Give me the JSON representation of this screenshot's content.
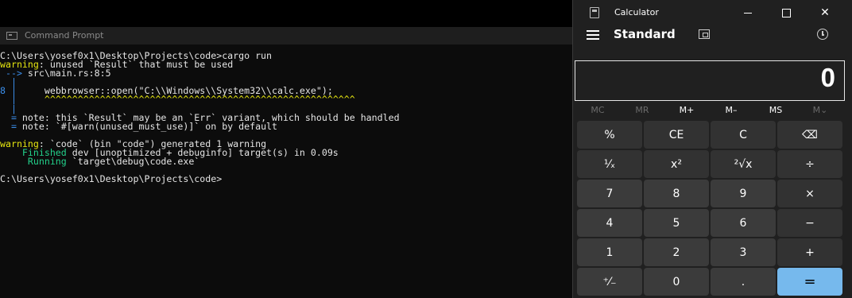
{
  "cmd": {
    "title": "Command Prompt",
    "lines": [
      [
        {
          "t": "C:\\Users\\yosef0x1\\Desktop\\Projects\\code>cargo run",
          "c": "w"
        }
      ],
      [
        {
          "t": "warning",
          "c": "y"
        },
        {
          "t": ": unused `Result` that must be used",
          "c": "w"
        }
      ],
      [
        {
          "t": " --> ",
          "c": "b"
        },
        {
          "t": "src\\main.rs:8:5",
          "c": "w"
        }
      ],
      [
        {
          "t": "  |",
          "c": "b"
        }
      ],
      [
        {
          "t": "8 |",
          "c": "b"
        },
        {
          "t": "     webbrowser::open(\"C:\\\\Windows\\\\System32\\\\calc.exe\");",
          "c": "w"
        }
      ],
      [
        {
          "t": "  |",
          "c": "b"
        },
        {
          "t": "     ^^^^^^^^^^^^^^^^^^^^^^^^^^^^^^^^^^^^^^^^^^^^^^^^^^^^^^^^",
          "c": "y"
        }
      ],
      [
        {
          "t": "  |",
          "c": "b"
        }
      ],
      [
        {
          "t": "  = ",
          "c": "b"
        },
        {
          "t": "note",
          "c": "w"
        },
        {
          "t": ": this `Result` may be an `Err` variant, which should be handled",
          "c": "w"
        }
      ],
      [
        {
          "t": "  = ",
          "c": "b"
        },
        {
          "t": "note",
          "c": "w"
        },
        {
          "t": ": `#[warn(unused_must_use)]` on by default",
          "c": "w"
        }
      ],
      [
        {
          "t": "",
          "c": "w"
        }
      ],
      [
        {
          "t": "warning",
          "c": "y"
        },
        {
          "t": ": `code` (bin \"code\") generated 1 warning",
          "c": "w"
        }
      ],
      [
        {
          "t": "    Finished",
          "c": "g"
        },
        {
          "t": " dev [unoptimized + debuginfo] target(s) in 0.09s",
          "c": "w"
        }
      ],
      [
        {
          "t": "     Running",
          "c": "g"
        },
        {
          "t": " `target\\debug\\code.exe`",
          "c": "w"
        }
      ],
      [
        {
          "t": "",
          "c": "w"
        }
      ],
      [
        {
          "t": "C:\\Users\\yosef0x1\\Desktop\\Projects\\code>",
          "c": "w"
        }
      ]
    ]
  },
  "calculator": {
    "title": "Calculator",
    "mode": "Standard",
    "display": "0",
    "memory": [
      {
        "label": "MC",
        "enabled": false
      },
      {
        "label": "MR",
        "enabled": false
      },
      {
        "label": "M+",
        "enabled": true
      },
      {
        "label": "M–",
        "enabled": true
      },
      {
        "label": "MS",
        "enabled": true
      },
      {
        "label": "M⌄",
        "enabled": false
      }
    ],
    "keys": [
      [
        "%",
        "CE",
        "C",
        "⌫"
      ],
      [
        "¹⁄ₓ",
        "x²",
        "²√x",
        "÷"
      ],
      [
        "7",
        "8",
        "9",
        "×"
      ],
      [
        "4",
        "5",
        "6",
        "−"
      ],
      [
        "1",
        "2",
        "3",
        "+"
      ],
      [
        "⁺⁄₋",
        "0",
        ".",
        "="
      ]
    ],
    "key_names": [
      [
        "percent-button",
        "clear-entry-button",
        "clear-button",
        "backspace-button"
      ],
      [
        "reciprocal-button",
        "square-button",
        "square-root-button",
        "divide-button"
      ],
      [
        "digit-7-button",
        "digit-8-button",
        "digit-9-button",
        "multiply-button"
      ],
      [
        "digit-4-button",
        "digit-5-button",
        "digit-6-button",
        "subtract-button"
      ],
      [
        "digit-1-button",
        "digit-2-button",
        "digit-3-button",
        "add-button"
      ],
      [
        "negate-button",
        "digit-0-button",
        "decimal-button",
        "equals-button"
      ]
    ],
    "icons": {
      "menu": "hamburger-icon",
      "keep_on_top": "keep-on-top-icon",
      "history": "history-icon",
      "app": "calculator-icon"
    },
    "colors": {
      "equals": "#76b9ed",
      "number_key": "#3b3b3b",
      "op_key": "#323232",
      "background": "#202020"
    }
  }
}
